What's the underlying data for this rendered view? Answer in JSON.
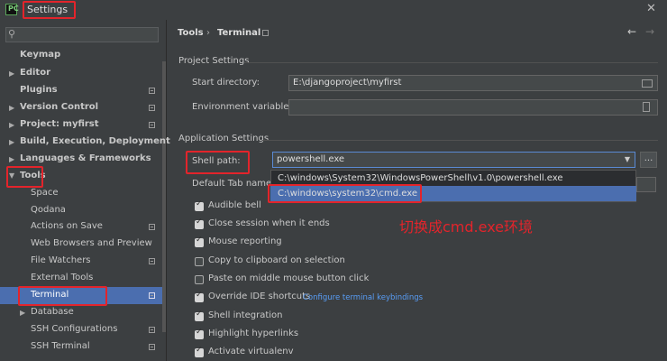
{
  "window": {
    "title": "Settings",
    "close_glyph": "✕"
  },
  "sidebar": {
    "search_placeholder": "",
    "items": [
      {
        "label": "Keymap",
        "bold": true
      },
      {
        "label": "Editor",
        "bold": true,
        "arrow": "right"
      },
      {
        "label": "Plugins",
        "bold": true
      },
      {
        "label": "Version Control",
        "bold": true,
        "arrow": "right"
      },
      {
        "label": "Project: myfirst",
        "bold": true,
        "arrow": "right"
      },
      {
        "label": "Build, Execution, Deployment",
        "bold": true,
        "arrow": "right"
      },
      {
        "label": "Languages & Frameworks",
        "bold": true,
        "arrow": "right"
      },
      {
        "label": "Tools",
        "bold": true,
        "arrow": "down"
      },
      {
        "label": "Space"
      },
      {
        "label": "Qodana"
      },
      {
        "label": "Actions on Save"
      },
      {
        "label": "Web Browsers and Preview"
      },
      {
        "label": "File Watchers"
      },
      {
        "label": "External Tools"
      },
      {
        "label": "Terminal",
        "selected": true
      },
      {
        "label": "Database",
        "arrow": "right"
      },
      {
        "label": "SSH Configurations"
      },
      {
        "label": "SSH Terminal"
      }
    ]
  },
  "breadcrumb": {
    "parent": "Tools",
    "separator": "›",
    "current": "Terminal"
  },
  "nav": {
    "back": "←",
    "forward": "→"
  },
  "project_settings": {
    "header": "Project Settings",
    "start_directory_label": "Start directory:",
    "start_directory_value": "E:\\djangoproject\\myfirst",
    "env_vars_label": "Environment variables:",
    "env_vars_value": ""
  },
  "app_settings": {
    "header": "Application Settings",
    "shell_path_label": "Shell path:",
    "shell_path_value": "powershell.exe",
    "dots": "...",
    "default_tab_label": "Default Tab name:",
    "dropdown_options": [
      "C:\\windows\\System32\\WindowsPowerShell\\v1.0\\powershell.exe",
      "C:\\windows\\system32\\cmd.exe"
    ],
    "checkboxes": [
      {
        "label": "Audible bell",
        "checked": true
      },
      {
        "label": "Close session when it ends",
        "checked": true
      },
      {
        "label": "Mouse reporting",
        "checked": true
      },
      {
        "label": "Copy to clipboard on selection",
        "checked": false
      },
      {
        "label": "Paste on middle mouse button click",
        "checked": false
      },
      {
        "label": "Override IDE shortcuts",
        "checked": true
      },
      {
        "label": "Shell integration",
        "checked": true
      },
      {
        "label": "Highlight hyperlinks",
        "checked": true
      },
      {
        "label": "Activate virtualenv",
        "checked": true
      }
    ],
    "configure_link": "Configure terminal keybindings"
  },
  "annotation": {
    "text": "切换成cmd.exe环境",
    "color": "#e3242b"
  },
  "colors": {
    "selection": "#4b6eaf",
    "link": "#589df6",
    "annotation_red": "#e3242b"
  }
}
